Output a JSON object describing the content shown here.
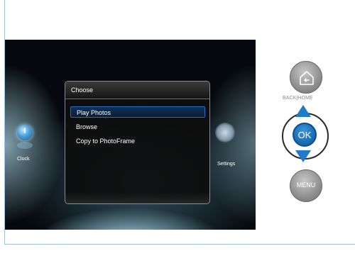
{
  "screen": {
    "clock_label": "Clock",
    "settings_label": "Settings"
  },
  "dialog": {
    "title": "Choose",
    "items": [
      {
        "label": "Play Photos",
        "selected": true
      },
      {
        "label": "Browse",
        "selected": false
      },
      {
        "label": "Copy to PhotoFrame",
        "selected": false
      }
    ]
  },
  "controls": {
    "back_home_label": "BACK|HOME",
    "ok_label": "OK",
    "menu_label": "MENU",
    "accent_color": "#1f7ac7",
    "home_icon": "home-icon",
    "up_icon": "up-arrow-icon",
    "down_icon": "down-arrow-icon"
  }
}
